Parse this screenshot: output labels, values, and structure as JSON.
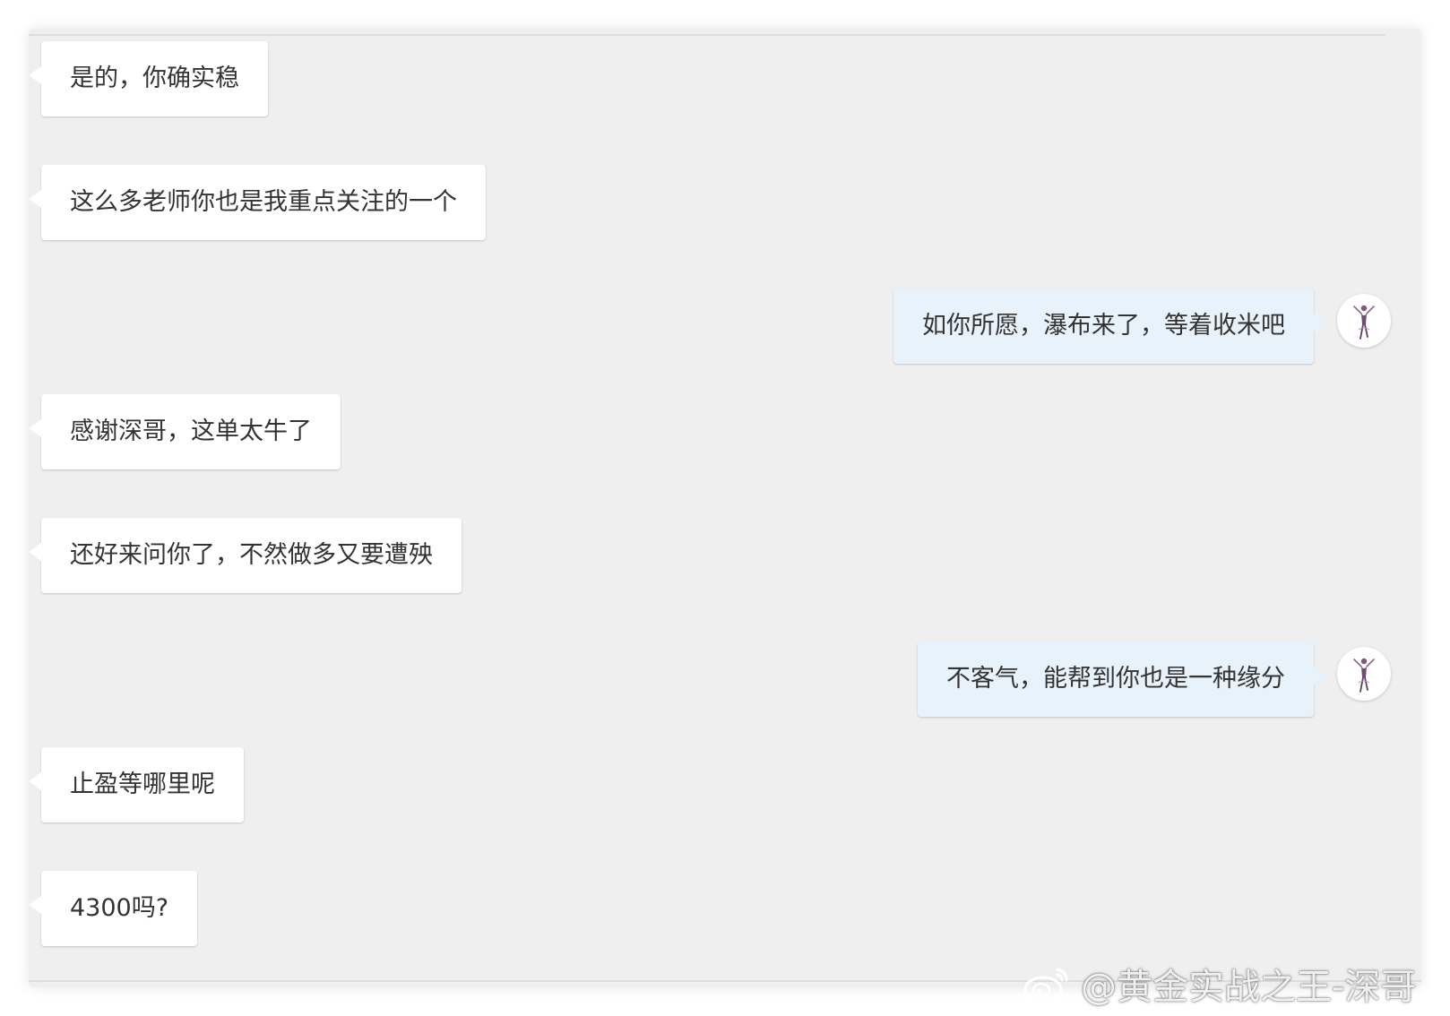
{
  "messages": [
    {
      "side": "left",
      "text": "是的，你确实稳"
    },
    {
      "side": "left",
      "text": "这么多老师你也是我重点关注的一个"
    },
    {
      "side": "right",
      "text": "如你所愿，瀑布来了，等着收米吧"
    },
    {
      "side": "left",
      "text": "感谢深哥，这单太牛了"
    },
    {
      "side": "left",
      "text": "还好来问你了，不然做多又要遭殃"
    },
    {
      "side": "right",
      "text": "不客气，能帮到你也是一种缘分"
    },
    {
      "side": "left",
      "text": "止盈等哪里呢"
    },
    {
      "side": "left",
      "text": "4300吗?"
    }
  ],
  "watermark": {
    "icon": "weibo-icon",
    "text": "@黄金实战之王-深哥"
  },
  "colors": {
    "panel_background": "#efefef",
    "incoming_bubble": "#ffffff",
    "outgoing_bubble": "#e8f2fb",
    "message_text": "#333333"
  }
}
